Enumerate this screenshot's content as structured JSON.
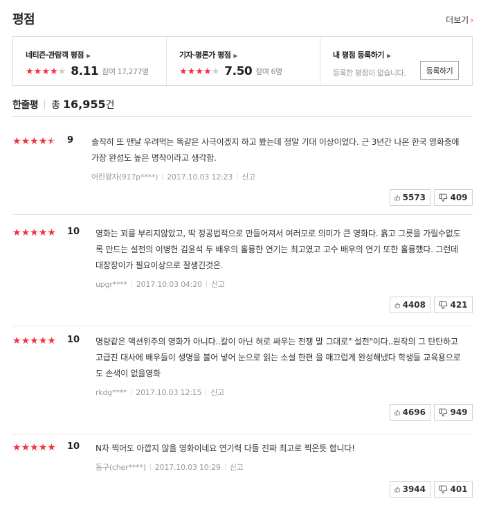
{
  "header": {
    "title": "평점",
    "more_label": "더보기"
  },
  "summary": {
    "netizen": {
      "label": "네티즌·관람객 평점",
      "score": "8.11",
      "participants": "참여 17,277명",
      "stars": [
        1,
        1,
        1,
        1,
        0
      ]
    },
    "critic": {
      "label": "기자·평론가 평점",
      "score": "7.50",
      "participants": "참여 6명",
      "stars": [
        1,
        1,
        1,
        1,
        0
      ]
    },
    "mine": {
      "label": "내 평점 등록하기",
      "message": "등록한 평점이 없습니다.",
      "button": "등록하기"
    }
  },
  "comments": {
    "label": "한줄평",
    "total_prefix": "총",
    "total": "16,955",
    "total_suffix": "건"
  },
  "reviews": [
    {
      "score": "9",
      "stars": [
        1,
        1,
        1,
        1,
        0.5
      ],
      "text": "솔직히 또 맨날 우려먹는 똑같은 사극이겠지 하고 봤는데 정말 기대 이상이었다. 근 3년간 나온 한국 영화중에 가장 완성도 높은 명작이라고 생각함.",
      "author": "어린왕자(917p****)",
      "date": "2017.10.03 12:23",
      "report": "신고",
      "likes": "5573",
      "dislikes": "409"
    },
    {
      "score": "10",
      "stars": [
        1,
        1,
        1,
        1,
        1
      ],
      "text": "영화는 꾀를 부리지않았고, 딱 정공법적으로 만들어져서 여러모로 의미가 큰 영화다. 흙고 그릇을 가릴수없도록 만드는 설전의 이병헌 김윤석 두 배우의 훌륭한 연기는 최고였고 고수 배우의 연기 또한 훌륭했다. 그런데 대장장이가 필요이상으로 잘생긴것은.",
      "author": "upgr****",
      "date": "2017.10.03 04:20",
      "report": "신고",
      "likes": "4408",
      "dislikes": "421"
    },
    {
      "score": "10",
      "stars": [
        1,
        1,
        1,
        1,
        1
      ],
      "text": "명량같은 액션위주의 영화가 아니다..칼이 아닌 혀로 싸우는 전쟁 말 그대로\" 설전\"이다..원작의 그 탄탄하고 고급진 대사에 배우들이 생명을 불어 넣어 눈으로 읽는 소설 한편 을 매끄럽게 완성해냈다 학생들 교육용으로도 손색이 없을영화",
      "author": "rkdg****",
      "date": "2017.10.03 12:15",
      "report": "신고",
      "likes": "4696",
      "dislikes": "949"
    },
    {
      "score": "10",
      "stars": [
        1,
        1,
        1,
        1,
        1
      ],
      "text": "N차 찍어도 아깝지 않을 영화이네요 연기력 다들 진짜 최고로 찍은듯 합니다!",
      "author": "동구(cher****)",
      "date": "2017.10.03 10:29",
      "report": "신고",
      "likes": "3944",
      "dislikes": "401"
    }
  ],
  "colors": {
    "accent": "#f5303d",
    "star_off": "#cccccc"
  }
}
